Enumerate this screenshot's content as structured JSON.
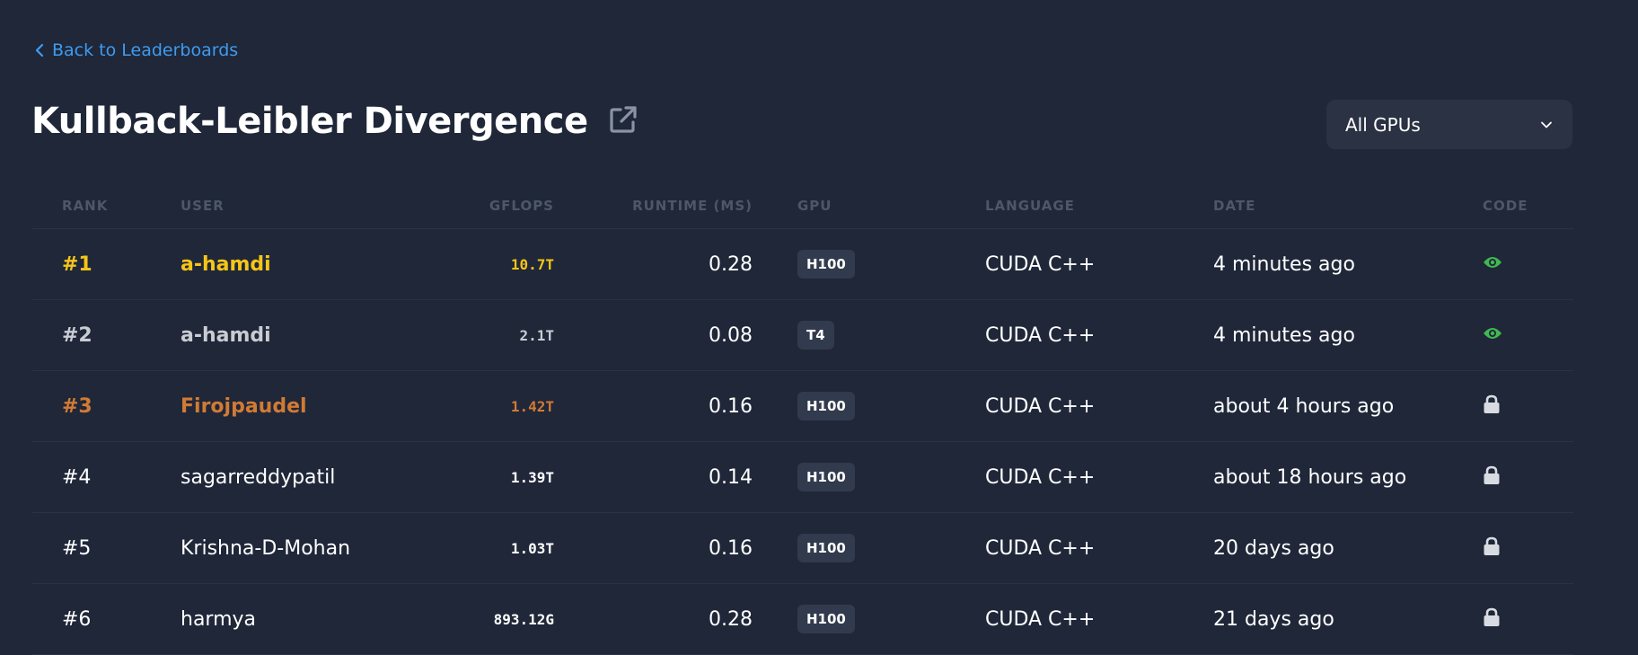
{
  "nav": {
    "back_label": "Back to Leaderboards"
  },
  "header": {
    "title": "Kullback-Leibler Divergence"
  },
  "filter": {
    "gpu_selected": "All GPUs"
  },
  "table": {
    "columns": [
      "RANK",
      "USER",
      "GFLOPS",
      "RUNTIME (MS)",
      "GPU",
      "LANGUAGE",
      "DATE",
      "CODE"
    ],
    "rows": [
      {
        "rank": "#1",
        "user": "a-hamdi",
        "gflops": "10.7T",
        "runtime": "0.28",
        "gpu": "H100",
        "language": "CUDA C++",
        "date": "4 minutes ago",
        "code": "eye-icon"
      },
      {
        "rank": "#2",
        "user": "a-hamdi",
        "gflops": "2.1T",
        "runtime": "0.08",
        "gpu": "T4",
        "language": "CUDA C++",
        "date": "4 minutes ago",
        "code": "eye-icon"
      },
      {
        "rank": "#3",
        "user": "Firojpaudel",
        "gflops": "1.42T",
        "runtime": "0.16",
        "gpu": "H100",
        "language": "CUDA C++",
        "date": "about 4 hours ago",
        "code": "lock-icon"
      },
      {
        "rank": "#4",
        "user": "sagarreddypatil",
        "gflops": "1.39T",
        "runtime": "0.14",
        "gpu": "H100",
        "language": "CUDA C++",
        "date": "about 18 hours ago",
        "code": "lock-icon"
      },
      {
        "rank": "#5",
        "user": "Krishna-D-Mohan",
        "gflops": "1.03T",
        "runtime": "0.16",
        "gpu": "H100",
        "language": "CUDA C++",
        "date": "20 days ago",
        "code": "lock-icon"
      },
      {
        "rank": "#6",
        "user": "harmya",
        "gflops": "893.12G",
        "runtime": "0.28",
        "gpu": "H100",
        "language": "CUDA C++",
        "date": "21 days ago",
        "code": "lock-icon"
      }
    ]
  },
  "colors": {
    "background": "#1f2739",
    "link": "#3f9bf0",
    "gold": "#f5c518",
    "silver": "#c9ccd3",
    "bronze": "#d27a34",
    "eye": "#3fb950",
    "lock": "#d8dbe1"
  },
  "icons": {
    "back": "chevron-left-icon",
    "title_action": "external-link-icon",
    "select": "chevron-down-icon"
  }
}
